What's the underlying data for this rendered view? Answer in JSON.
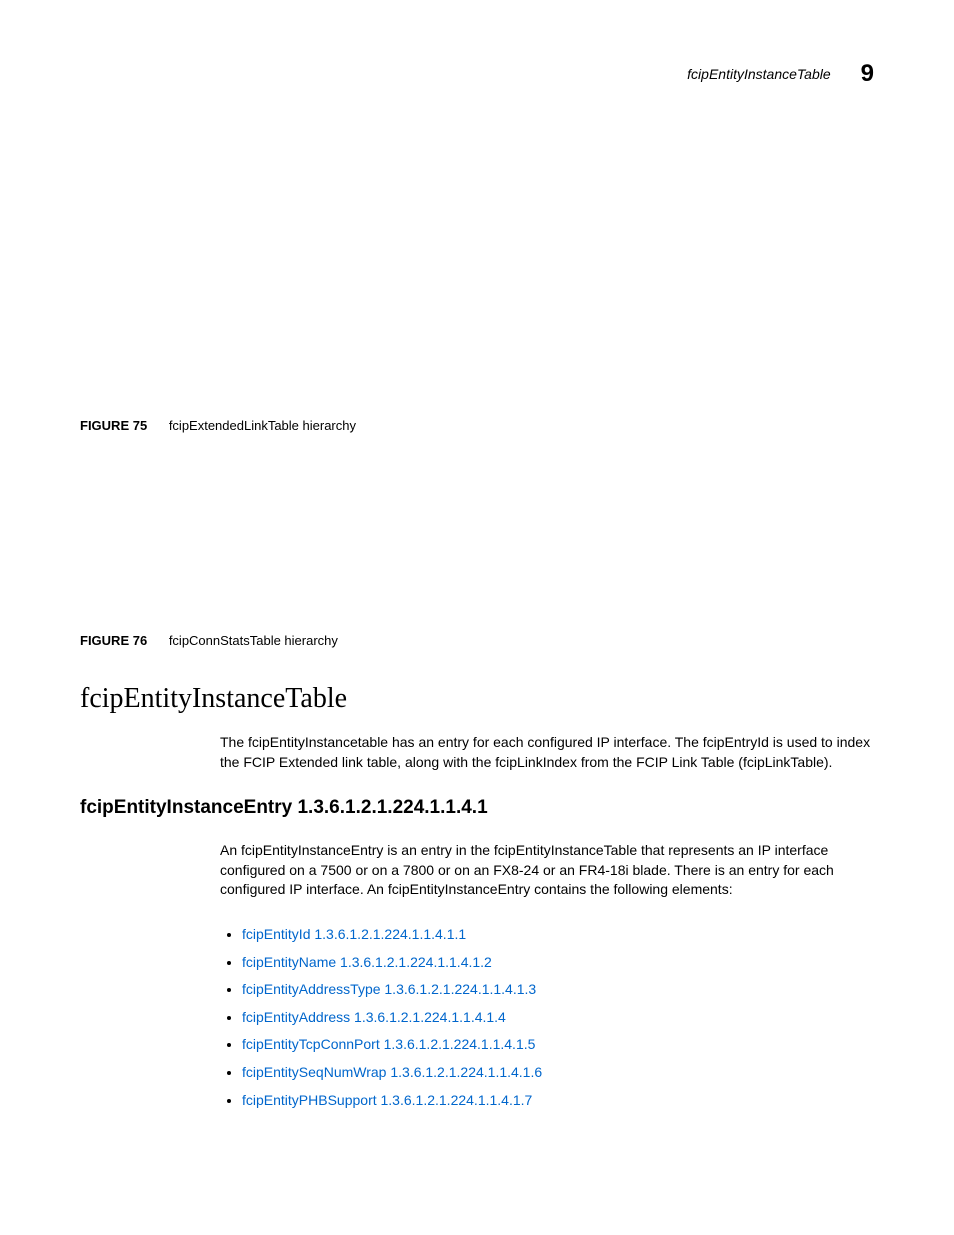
{
  "header": {
    "running_title": "fcipEntityInstanceTable",
    "chapter_number": "9"
  },
  "figures": [
    {
      "label": "FIGURE 75",
      "caption": "fcipExtendedLinkTable hierarchy"
    },
    {
      "label": "FIGURE 76",
      "caption": "fcipConnStatsTable hierarchy"
    }
  ],
  "section": {
    "title": "fcipEntityInstanceTable",
    "intro": "The fcipEntityInstancetable has an entry for each configured IP interface. The fcipEntryId is used to index the FCIP Extended link table, along with the fcipLinkIndex from the FCIP Link Table (fcipLinkTable)."
  },
  "subsection": {
    "title": "fcipEntityInstanceEntry 1.3.6.1.2.1.224.1.1.4.1",
    "intro": "An fcipEntityInstanceEntry is an entry in the fcipEntityInstanceTable that represents an IP interface configured on a 7500 or on a 7800 or on an FX8-24 or an FR4-18i blade. There is an entry for each configured IP interface. An fcipEntityInstanceEntry contains the following elements:",
    "items": [
      "fcipEntityId 1.3.6.1.2.1.224.1.1.4.1.1",
      "fcipEntityName 1.3.6.1.2.1.224.1.1.4.1.2",
      "fcipEntityAddressType 1.3.6.1.2.1.224.1.1.4.1.3",
      "fcipEntityAddress 1.3.6.1.2.1.224.1.1.4.1.4",
      "fcipEntityTcpConnPort 1.3.6.1.2.1.224.1.1.4.1.5",
      "fcipEntitySeqNumWrap 1.3.6.1.2.1.224.1.1.4.1.6",
      "fcipEntityPHBSupport 1.3.6.1.2.1.224.1.1.4.1.7"
    ]
  }
}
